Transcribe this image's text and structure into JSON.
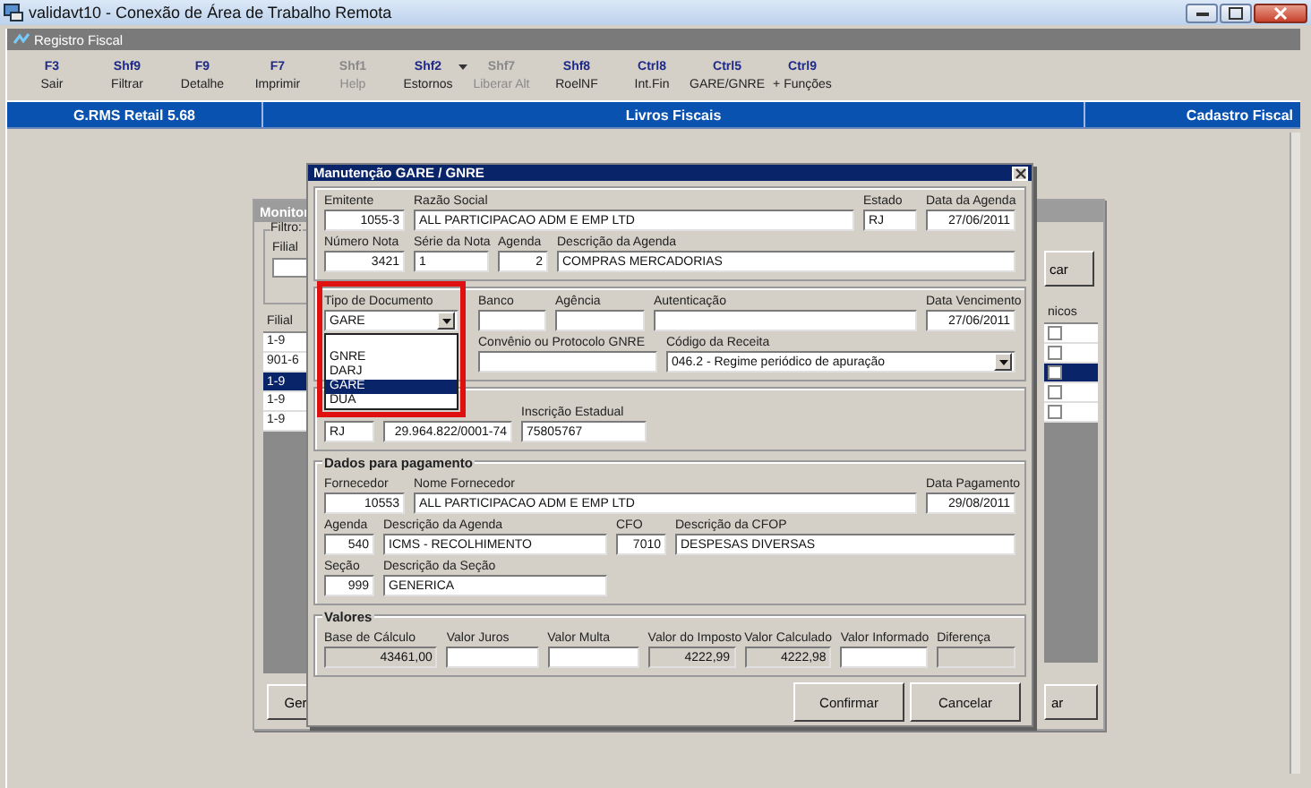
{
  "window": {
    "title": "validavt10 - Conexão de Área de Trabalho Remota"
  },
  "app": {
    "title": "Registro Fiscal"
  },
  "toolbar": [
    {
      "key": "F3",
      "label": "Sair",
      "disabled": false,
      "has_menu": false
    },
    {
      "key": "Shf9",
      "label": "Filtrar",
      "disabled": false,
      "has_menu": false
    },
    {
      "key": "F9",
      "label": "Detalhe",
      "disabled": false,
      "has_menu": false
    },
    {
      "key": "F7",
      "label": "Imprimir",
      "disabled": false,
      "has_menu": false
    },
    {
      "key": "Shf1",
      "label": "Help",
      "disabled": true,
      "has_menu": false
    },
    {
      "key": "Shf2",
      "label": "Estornos",
      "disabled": false,
      "has_menu": true
    },
    {
      "key": "Shf7",
      "label": "Liberar Alt",
      "disabled": true,
      "has_menu": false
    },
    {
      "key": "Shf8",
      "label": "RoelNF",
      "disabled": false,
      "has_menu": false
    },
    {
      "key": "Ctrl8",
      "label": "Int.Fin",
      "disabled": false,
      "has_menu": false
    },
    {
      "key": "Ctrl5",
      "label": "GARE/GNRE",
      "disabled": false,
      "has_menu": false
    },
    {
      "key": "Ctrl9",
      "label": "+ Funções",
      "disabled": false,
      "has_menu": false
    }
  ],
  "modules": [
    "G.RMS Retail 5.68",
    "Livros Fiscais",
    "Cadastro Fiscal"
  ],
  "background_window": {
    "title": "Monitor",
    "filter_title": "Filtro:",
    "filter_label": "Filial",
    "search_button": "car",
    "columns": [
      "Filial",
      "nicos"
    ],
    "rows": [
      {
        "filial": "1-9",
        "selected": false,
        "checked": false
      },
      {
        "filial": "901-6",
        "selected": false,
        "checked": false
      },
      {
        "filial": "1-9",
        "selected": true,
        "checked": false
      },
      {
        "filial": "1-9",
        "selected": false,
        "checked": false
      },
      {
        "filial": "1-9",
        "selected": false,
        "checked": false
      }
    ],
    "buttons": [
      "Ger",
      "ar"
    ]
  },
  "dialog": {
    "title": "Manutenção GARE / GNRE",
    "sections": [
      {
        "rows": [
          {
            "fields": [
              {
                "label": "Emitente",
                "value": "1055-3",
                "kind": "number"
              },
              {
                "label": "Razão Social",
                "value": "ALL PARTICIPACAO ADM E EMP LTD",
                "kind": "text"
              },
              {
                "label": "Estado",
                "value": "RJ",
                "kind": "text"
              },
              {
                "label": "Data da Agenda",
                "value": "27/06/2011",
                "kind": "number"
              }
            ]
          },
          {
            "fields": [
              {
                "label": "Número Nota",
                "value": "3421",
                "kind": "number"
              },
              {
                "label": "Série da Nota",
                "value": "1",
                "kind": "text"
              },
              {
                "label": "Agenda",
                "value": "2",
                "kind": "number"
              },
              {
                "label": "Descrição da Agenda",
                "value": "COMPRAS MERCADORIAS",
                "kind": "text"
              }
            ]
          }
        ]
      },
      {
        "rows": [
          {
            "fields": [
              {
                "label": "Tipo de Documento",
                "value": "GARE",
                "kind": "select",
                "highlighted": true,
                "open": true,
                "options": [
                  {
                    "label": "GNRE",
                    "selected": false
                  },
                  {
                    "label": "DARJ",
                    "selected": false
                  },
                  {
                    "label": "GARE",
                    "selected": true
                  },
                  {
                    "label": "DUA",
                    "selected": false
                  }
                ]
              },
              {
                "label": "Banco",
                "kind": "text"
              },
              {
                "label": "Agência",
                "kind": "text"
              },
              {
                "label": "Autenticação",
                "kind": "text"
              },
              {
                "label": "Data Vencimento",
                "value": "27/06/2011",
                "kind": "number"
              }
            ]
          },
          {
            "fields": [
              {
                "label": "Convênio ou Protocolo GNRE",
                "kind": "text"
              },
              {
                "label": "Código da Receita",
                "value": "046.2 - Regime periódico de apuração",
                "kind": "select"
              }
            ]
          }
        ]
      },
      {
        "rows": [
          {
            "fields": [
              {
                "value": "RJ",
                "kind": "text"
              },
              {
                "value": "29.964.822/0001-74",
                "kind": "number"
              },
              {
                "label": "Inscrição Estadual",
                "value": "75805767",
                "kind": "text"
              }
            ]
          }
        ]
      },
      {
        "title": "Dados para pagamento",
        "rows": [
          {
            "fields": [
              {
                "label": "Fornecedor",
                "value": "10553",
                "kind": "number"
              },
              {
                "label": "Nome Fornecedor",
                "value": "ALL PARTICIPACAO ADM E EMP LTD",
                "kind": "text"
              },
              {
                "label": "Data Pagamento",
                "value": "29/08/2011",
                "kind": "number"
              }
            ]
          },
          {
            "fields": [
              {
                "label": "Agenda",
                "value": "540",
                "kind": "number"
              },
              {
                "label": "Descrição da Agenda",
                "value": "ICMS - RECOLHIMENTO",
                "kind": "text"
              },
              {
                "label": "CFO",
                "value": "7010",
                "kind": "number"
              },
              {
                "label": "Descrição da CFOP",
                "value": "DESPESAS DIVERSAS",
                "kind": "text"
              }
            ]
          },
          {
            "fields": [
              {
                "label": "Seção",
                "value": "999",
                "kind": "number"
              },
              {
                "label": "Descrição da Seção",
                "value": "GENERICA",
                "kind": "text"
              }
            ]
          }
        ]
      },
      {
        "title": "Valores",
        "rows": [
          {
            "fields": [
              {
                "label": "Base de Cálculo",
                "value": "43461,00",
                "kind": "readonly"
              },
              {
                "label": "Valor Juros",
                "kind": "text"
              },
              {
                "label": "Valor Multa",
                "kind": "text"
              },
              {
                "label": "Valor do Imposto",
                "value": "4222,99",
                "kind": "readonly"
              },
              {
                "label": "Valor Calculado",
                "value": "4222,98",
                "kind": "readonly"
              },
              {
                "label": "Valor Informado",
                "kind": "text"
              },
              {
                "label": "Diferença",
                "kind": "readonly"
              }
            ]
          }
        ]
      }
    ],
    "buttons": [
      "Confirmar",
      "Cancelar"
    ]
  }
}
